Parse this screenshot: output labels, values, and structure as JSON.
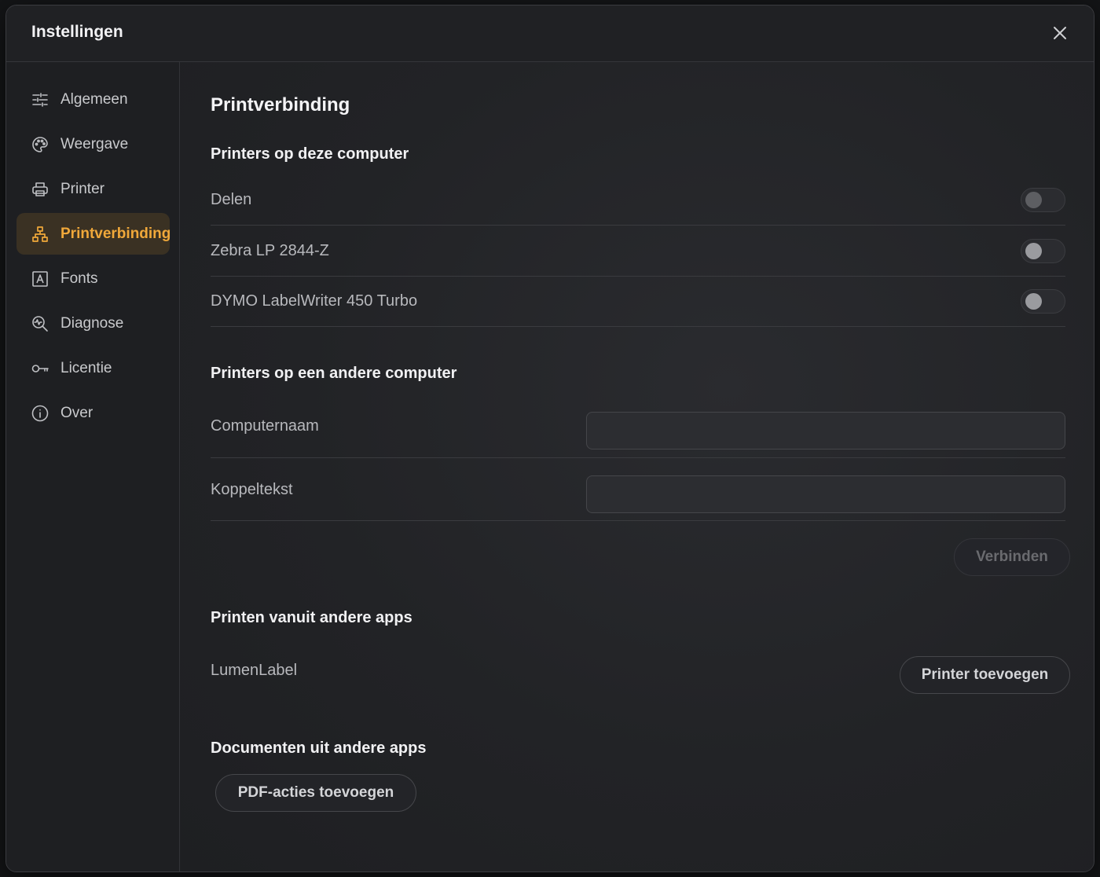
{
  "window": {
    "title": "Instellingen"
  },
  "sidebar": {
    "items": [
      {
        "label": "Algemeen",
        "icon": "sliders-icon",
        "active": false
      },
      {
        "label": "Weergave",
        "icon": "palette-icon",
        "active": false
      },
      {
        "label": "Printer",
        "icon": "printer-icon",
        "active": false
      },
      {
        "label": "Printverbinding",
        "icon": "network-icon",
        "active": true
      },
      {
        "label": "Fonts",
        "icon": "font-icon",
        "active": false
      },
      {
        "label": "Diagnose",
        "icon": "diagnose-icon",
        "active": false
      },
      {
        "label": "Licentie",
        "icon": "key-icon",
        "active": false
      },
      {
        "label": "Over",
        "icon": "info-icon",
        "active": false
      }
    ]
  },
  "colors": {
    "accent": "#f0a83a",
    "active_bg": "#3a3123"
  },
  "main": {
    "title": "Printverbinding",
    "local": {
      "heading": "Printers op deze computer",
      "rows": [
        {
          "label": "Delen",
          "on": false
        },
        {
          "label": "Zebra LP 2844-Z",
          "on": false
        },
        {
          "label": "DYMO LabelWriter 450 Turbo",
          "on": false
        }
      ]
    },
    "remote": {
      "heading": "Printers op een andere computer",
      "computer_label": "Computernaam",
      "computer_value": "",
      "pair_label": "Koppeltekst",
      "pair_value": "",
      "connect_label": "Verbinden"
    },
    "apps": {
      "heading": "Printen vanuit andere apps",
      "app_label": "LumenLabel",
      "add_printer_label": "Printer toevoegen"
    },
    "documents": {
      "heading": "Documenten uit andere apps",
      "pdf_label": "PDF-acties toevoegen"
    }
  }
}
